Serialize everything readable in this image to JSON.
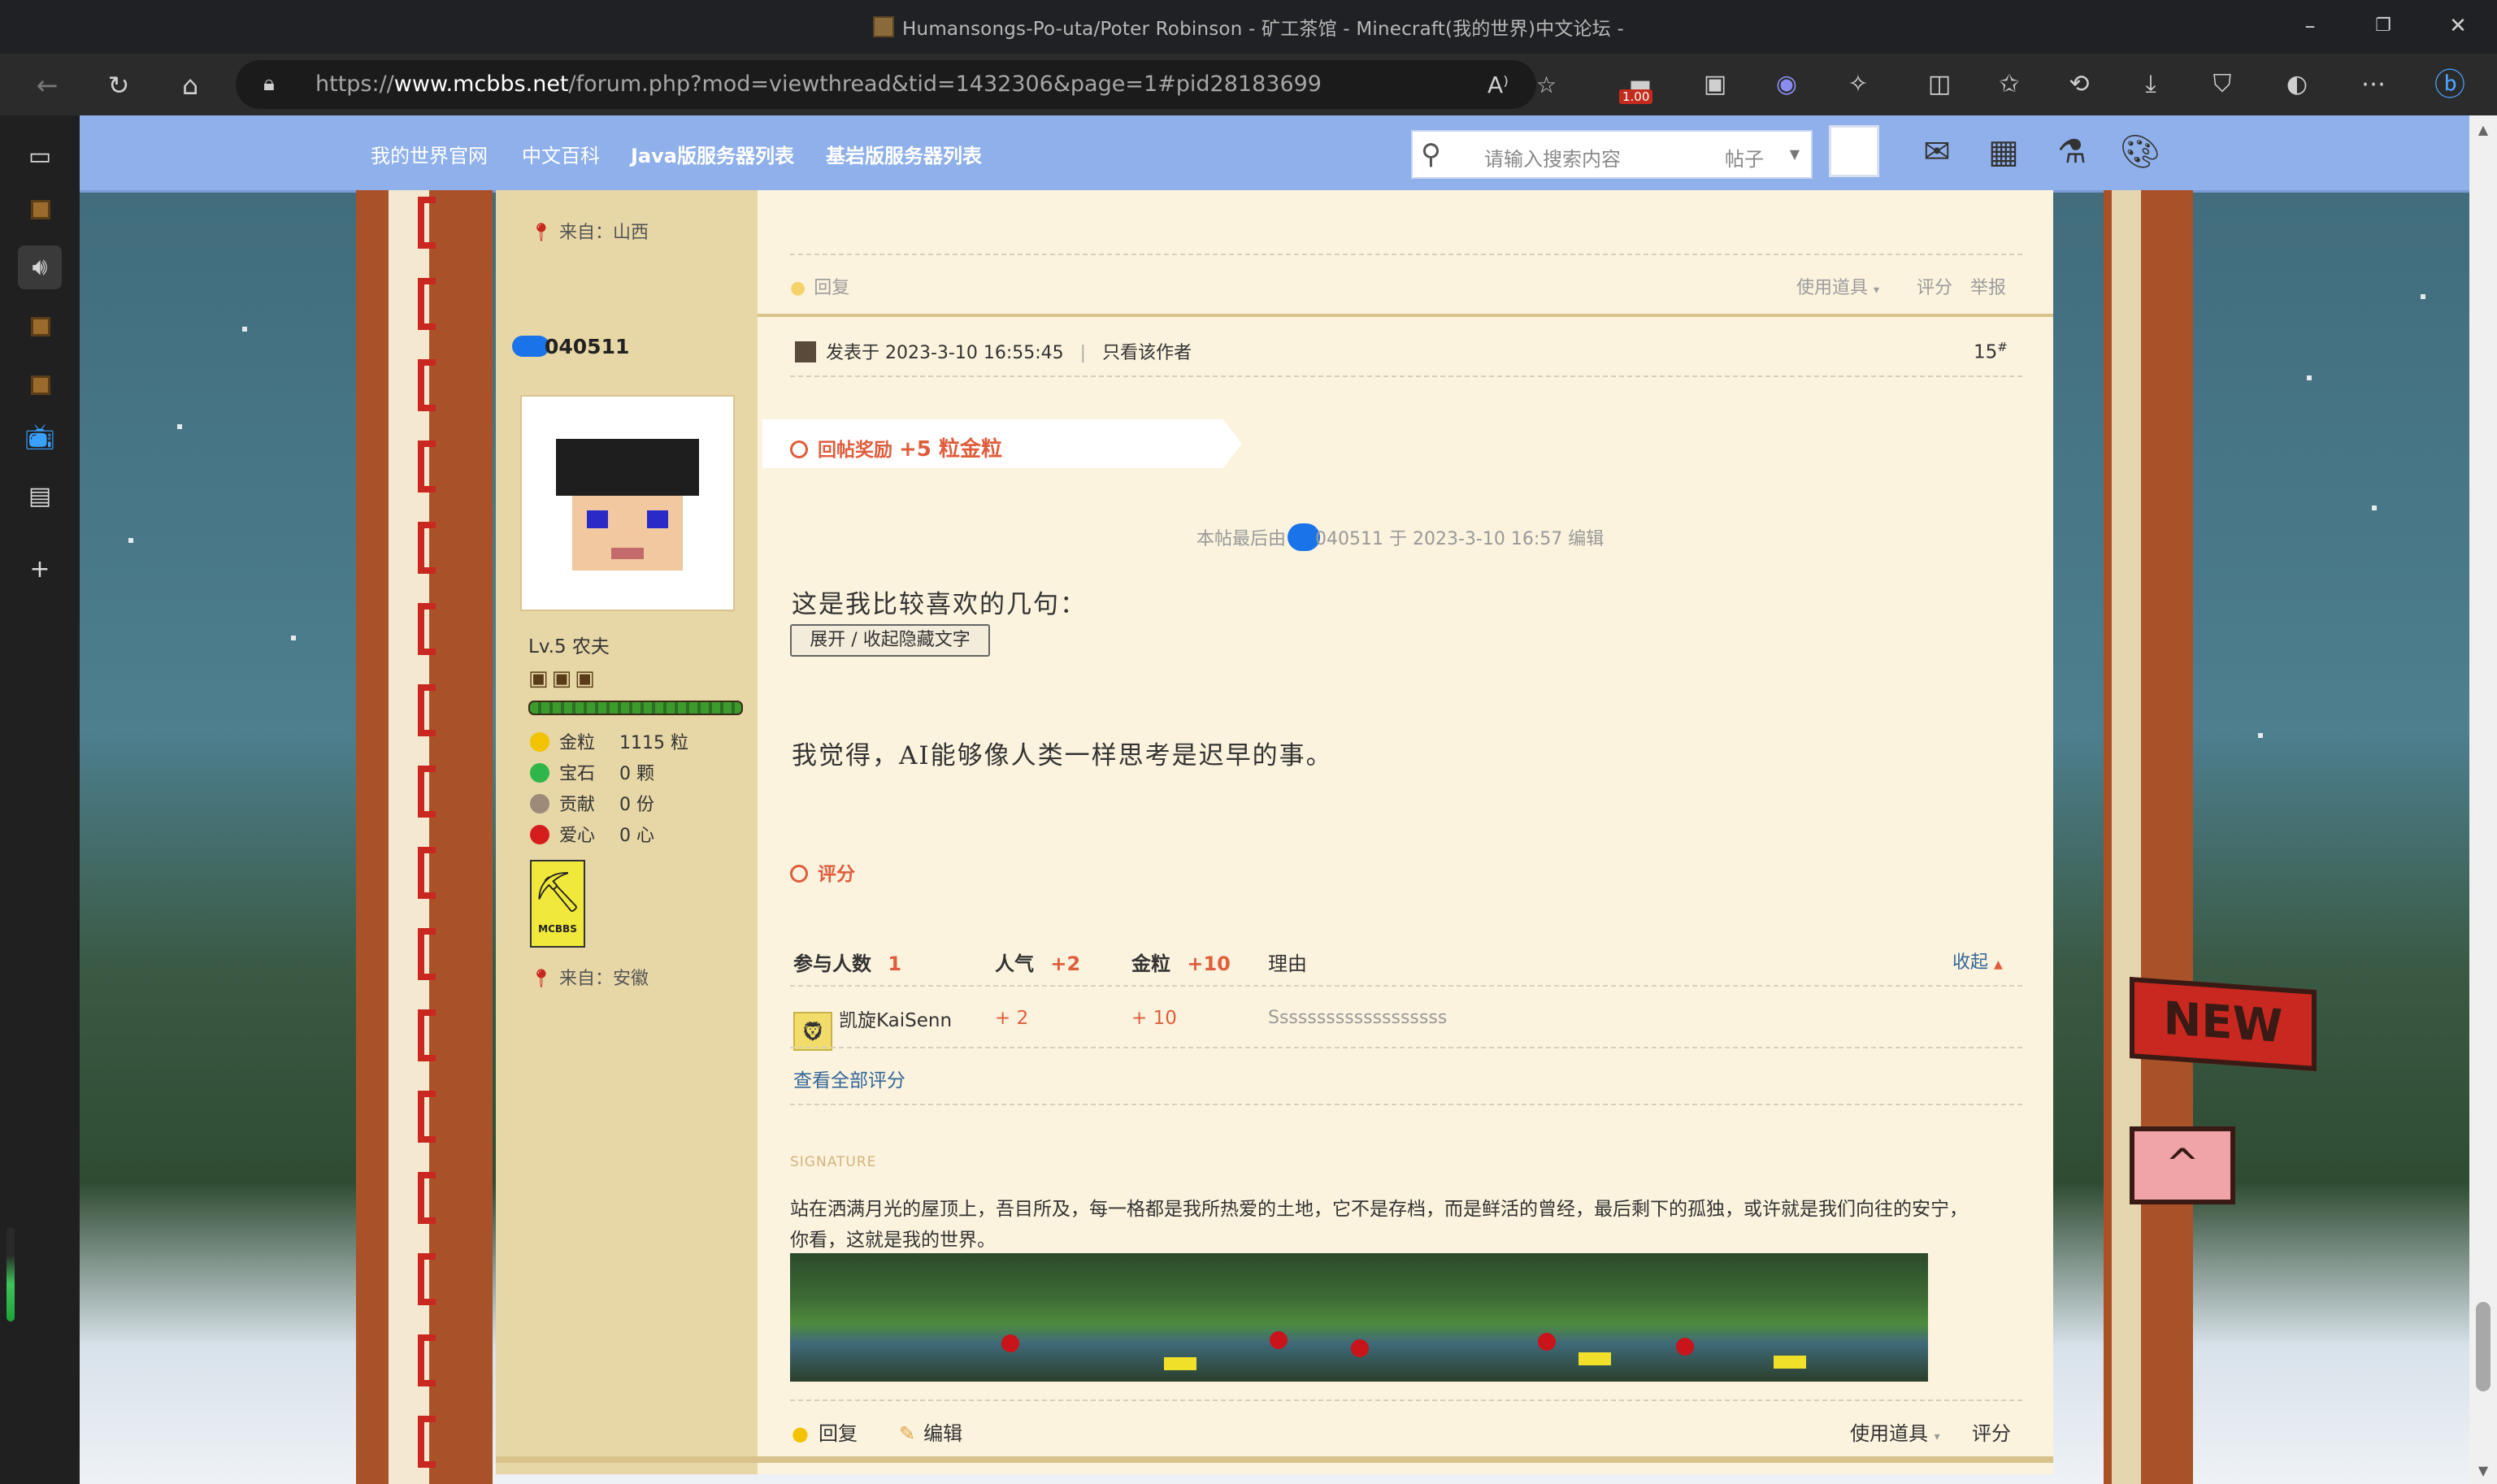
{
  "window": {
    "title": "Humansongs-Po-uta/Poter Robinson - 矿工茶馆 - Minecraft(我的世界)中文论坛 -"
  },
  "browser": {
    "url_prefix": "https://",
    "url_domain": "www.mcbbs.net",
    "url_path": "/forum.php?mod=viewthread&tid=1432306&page=1#pid28183699",
    "extension_badge": "1.00"
  },
  "forum_nav": {
    "links": [
      "我的世界官网",
      "中文百科",
      "Java版服务器列表",
      "基岩版服务器列表"
    ],
    "search_placeholder": "请输入搜索内容",
    "search_scope": "帖子"
  },
  "prev_post": {
    "from_label": "来自：山西",
    "reply": "回复",
    "use_item": "使用道具",
    "rate": "评分",
    "report": "举报"
  },
  "post": {
    "author": "040511",
    "meta_posted": "发表于 2023-3-10 16:55:45",
    "meta_only_author": "只看该作者",
    "floor": "15",
    "floor_suffix": "#",
    "reward_label": "回帖奖励",
    "reward_value": "+5 粒金粒",
    "edit_note_prefix": "本帖最后由",
    "edit_note_suffix": "040511 于 2023-3-10 16:57 编辑",
    "line1": "这是我比较喜欢的几句：",
    "toggle_hidden": "展开 / 收起隐藏文字",
    "line2": "我觉得，AI能够像人类一样思考是迟早的事。",
    "rating_title": "评分",
    "rating_header": {
      "participants_label": "参与人数",
      "participants_value": "1",
      "popularity_label": "人气",
      "popularity_value": "+2",
      "gold_label": "金粒",
      "gold_value": "+10",
      "reason_label": "理由",
      "collapse": "收起"
    },
    "rating_rows": [
      {
        "user": "凯旋KaiSenn",
        "popularity": "+ 2",
        "gold": "+ 10",
        "reason": "Sssssssssssssssssss"
      }
    ],
    "view_all_ratings": "查看全部评分",
    "signature_label": "SIGNATURE",
    "signature_line1": "站在洒满月光的屋顶上，吾目所及，每一格都是我所热爱的土地，它不是存档，而是鲜活的曾经，最后剩下的孤独，或许就是我们向往的安宁，",
    "signature_line2": "你看，这就是我的世界。",
    "footer": {
      "reply": "回复",
      "edit": "编辑",
      "use_item": "使用道具",
      "rate": "评分"
    }
  },
  "profile": {
    "level": "Lv.5 农夫",
    "stats": [
      {
        "label": "金粒",
        "value": "1115 粒",
        "icon": "gold-nugget-icon",
        "color": "#f2c300"
      },
      {
        "label": "宝石",
        "value": "0 颗",
        "icon": "emerald-icon",
        "color": "#2fb64a"
      },
      {
        "label": "贡献",
        "value": "0 份",
        "icon": "contribution-icon",
        "color": "#9d8a78"
      },
      {
        "label": "爱心",
        "value": "0 心",
        "icon": "apple-heart-icon",
        "color": "#d61d1d"
      }
    ],
    "medal_text": "MCBBS",
    "from_label": "来自：安徽"
  },
  "decor": {
    "new_flag": "NEW",
    "up_flag": "^"
  },
  "colors": {
    "nav_bg": "#8fb0ea",
    "accent_red": "#e05d3c",
    "link_blue": "#336699",
    "profile_bg": "#e7d6a6",
    "post_bg": "#fbf3de"
  }
}
